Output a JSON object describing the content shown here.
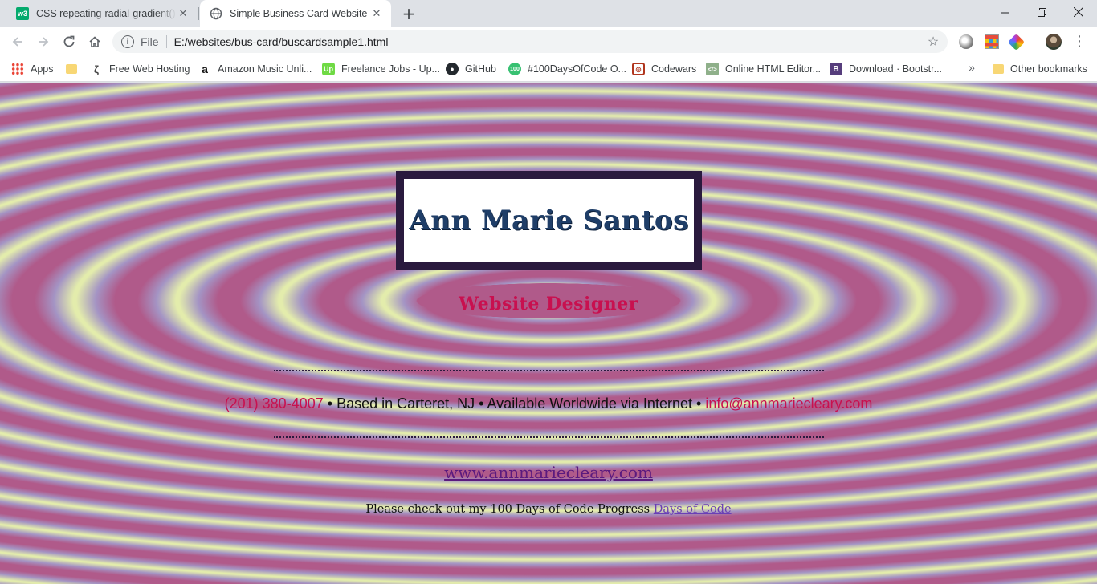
{
  "browser": {
    "tabs": [
      {
        "title": "CSS repeating-radial-gradient() fu",
        "favicon": "w3schools-icon",
        "active": false
      },
      {
        "title": "Simple Business Card Website",
        "favicon": "globe-icon",
        "active": true
      }
    ],
    "address": {
      "scheme_label": "File",
      "url": "E:/websites/bus-card/buscardsample1.html"
    },
    "bookmarks": [
      {
        "label": "Apps",
        "icon": "apps-grid-icon"
      },
      {
        "label": "",
        "icon": "folder-icon"
      },
      {
        "label": "Free Web Hosting",
        "icon": "wave-icon"
      },
      {
        "label": "Amazon Music Unli...",
        "icon": "amazon-icon"
      },
      {
        "label": "Freelance Jobs - Up...",
        "icon": "upwork-icon"
      },
      {
        "label": "GitHub",
        "icon": "github-icon"
      },
      {
        "label": "#100DaysOfCode O...",
        "icon": "100days-icon"
      },
      {
        "label": "Codewars",
        "icon": "codewars-icon"
      },
      {
        "label": "Online HTML Editor...",
        "icon": "html-editor-icon"
      },
      {
        "label": "Download · Bootstr...",
        "icon": "bootstrap-icon"
      }
    ],
    "more_bookmarks_label": "»",
    "other_bookmarks_label": "Other bookmarks"
  },
  "page": {
    "name": "Ann Marie Santos",
    "role": "Website Designer",
    "contact": {
      "phone": "(201) 380-4007",
      "bullet": "•",
      "location": "Based in Carteret, NJ",
      "availability": "Available Worldwide via Internet",
      "email": "info@annmariecleary.com"
    },
    "website": "www.annmariecleary.com",
    "progress_text": "Please check out my 100 Days of Code Progress",
    "progress_link": "Days of Code"
  },
  "colors": {
    "magenta_band": "#b05a8a",
    "yellow_band": "#e3ecac",
    "lavender_band": "#a494c4",
    "card_border": "#2a1a3e",
    "name_text": "#1f3e68",
    "accent_red": "#c8104f",
    "link_purple": "#5b1a7e"
  }
}
